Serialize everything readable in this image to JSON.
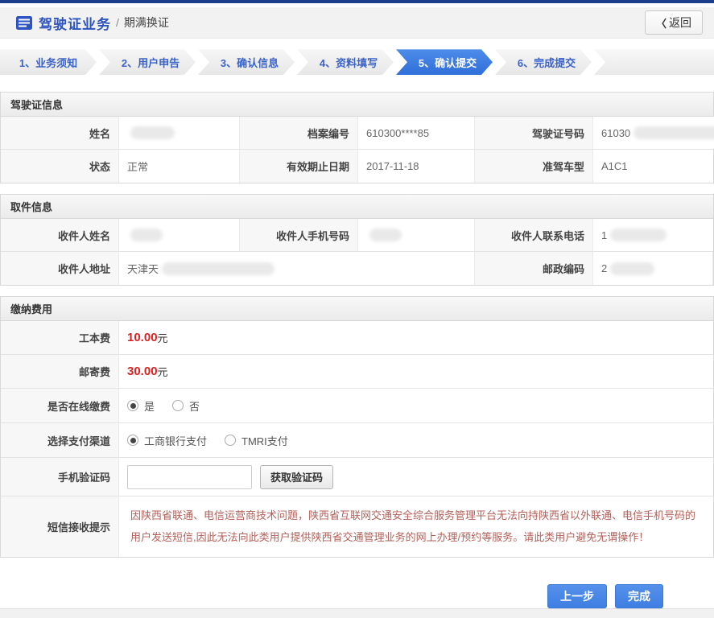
{
  "header": {
    "title": "驾驶证业务",
    "separator": "/",
    "subtitle": "期满换证",
    "back_arrow": "〈",
    "back_label": "返回"
  },
  "steps": {
    "items": [
      {
        "label": "1、业务须知",
        "active": false
      },
      {
        "label": "2、用户申告",
        "active": false
      },
      {
        "label": "3、确认信息",
        "active": false
      },
      {
        "label": "4、资料填写",
        "active": false
      },
      {
        "label": "5、确认提交",
        "active": true
      },
      {
        "label": "6、完成提交",
        "active": false
      }
    ]
  },
  "license_section": {
    "title": "驾驶证信息",
    "name_label": "姓名",
    "name_value": "",
    "file_no_label": "档案编号",
    "file_no_value": "610300****85",
    "license_no_label": "驾驶证号码",
    "license_no_value": "61030",
    "status_label": "状态",
    "status_value": "正常",
    "expiry_label": "有效期止日期",
    "expiry_value": "2017-11-18",
    "vehicle_class_label": "准驾车型",
    "vehicle_class_value": "A1C1"
  },
  "pickup_section": {
    "title": "取件信息",
    "recipient_name_label": "收件人姓名",
    "recipient_name_value": "",
    "recipient_mobile_label": "收件人手机号码",
    "recipient_mobile_value": "",
    "recipient_phone_label": "收件人联系电话",
    "recipient_phone_value": "1",
    "address_label": "收件人地址",
    "address_value": "天津天",
    "postcode_label": "邮政编码",
    "postcode_value": "2"
  },
  "fees_section": {
    "title": "缴纳费用",
    "production_fee_label": "工本费",
    "production_fee_value": "10.00",
    "mailing_fee_label": "邮寄费",
    "mailing_fee_value": "30.00",
    "currency_unit": "元",
    "online_payment_label": "是否在线缴费",
    "online_payment_options": [
      {
        "label": "是",
        "selected": true
      },
      {
        "label": "否",
        "selected": false
      }
    ],
    "payment_channel_label": "选择支付渠道",
    "payment_channel_options": [
      {
        "label": "工商银行支付",
        "selected": true
      },
      {
        "label": "TMRI支付",
        "selected": false
      }
    ],
    "sms_code_label": "手机验证码",
    "sms_code_value": "",
    "sms_code_placeholder": "",
    "get_code_button": "获取验证码",
    "sms_notice_label": "短信接收提示",
    "sms_notice_text": "因陕西省联通、电信运营商技术问题，陕西省互联网交通安全综合服务管理平台无法向持陕西省以外联通、电信手机号码的用户发送短信,因此无法向此类用户提供陕西省交通管理业务的网上办理/预约等服务。请此类用户避免无谓操作！"
  },
  "actions": {
    "prev_label": "上一步",
    "finish_label": "完成"
  },
  "colors": {
    "topbar_navy": "#1a3e8c",
    "accent_blue": "#3578e0",
    "step_text_blue": "#3a62c8",
    "fee_red": "#e02020",
    "notice_red": "#b35f58"
  }
}
